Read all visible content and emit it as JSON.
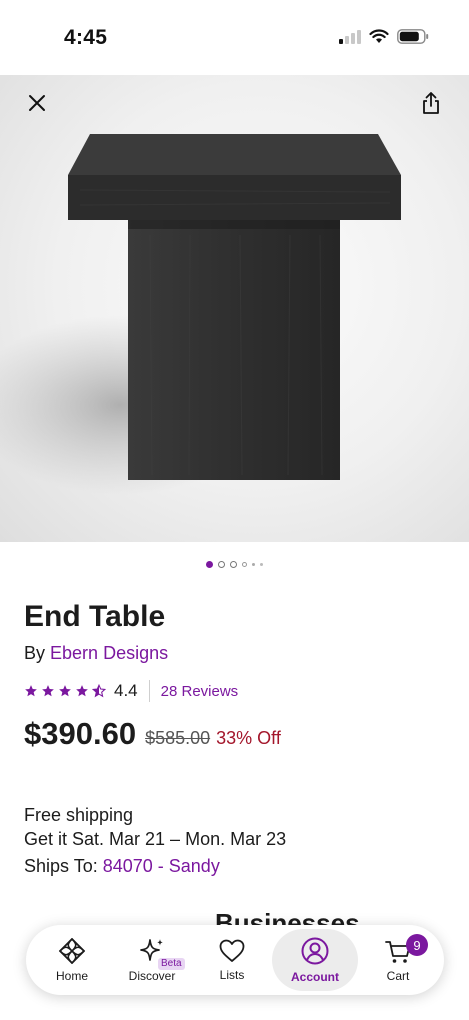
{
  "status_bar": {
    "time": "4:45"
  },
  "product": {
    "image_count": 6,
    "active_image": 1,
    "title": "End Table",
    "by_prefix": "By",
    "brand": "Ebern Designs",
    "rating": "4.4",
    "rating_stars": 4.4,
    "reviews": "28 Reviews",
    "price": "$390.60",
    "old_price": "$585.00",
    "discount": "33% Off"
  },
  "shipping": {
    "free_shipping": "Free shipping",
    "delivery": "Get it Sat. Mar 21 – Mon. Mar 23",
    "ships_to_label": "Ships To:",
    "ships_to_value": "84070 - Sandy"
  },
  "section_peek": "Businesses",
  "nav": {
    "home": "Home",
    "discover": "Discover",
    "beta": "Beta",
    "lists": "Lists",
    "account": "Account",
    "cart": "Cart",
    "cart_count": "9"
  },
  "colors": {
    "accent": "#7b189f",
    "discount": "#a3162b",
    "table": "#2e2e2e"
  }
}
